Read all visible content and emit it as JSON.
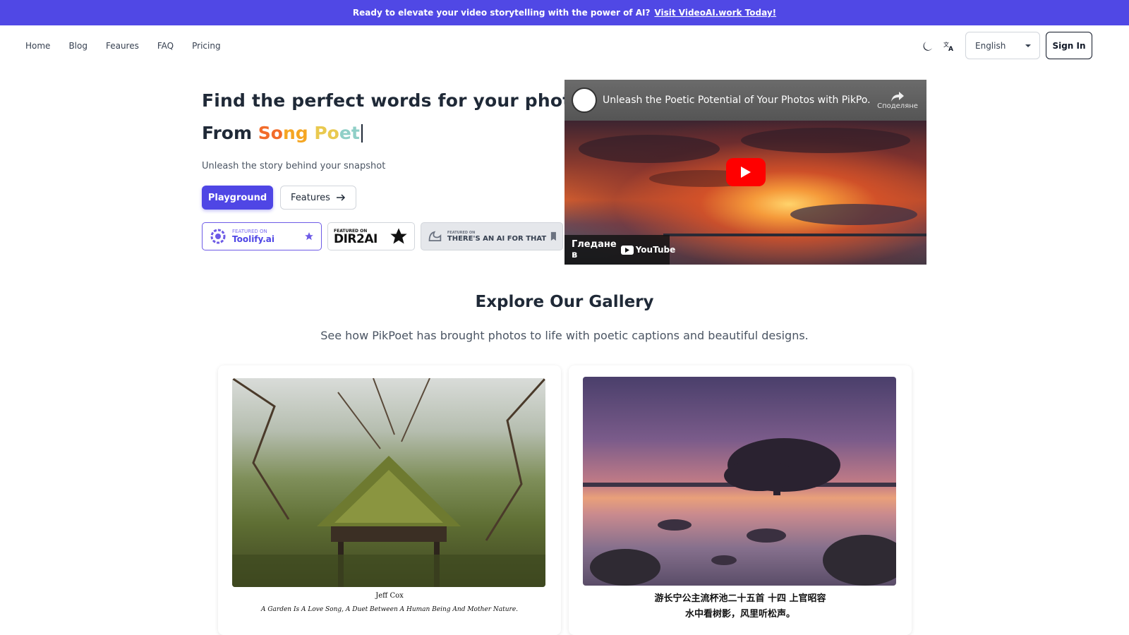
{
  "banner": {
    "text": "Ready to elevate your video storytelling with the power of AI?",
    "link": "Visit VideoAI.work Today!"
  },
  "nav": {
    "links": [
      "Home",
      "Blog",
      "Feaures",
      "FAQ",
      "Pricing"
    ],
    "language": "English",
    "sign_in": "Sign In",
    "icons": [
      "moon-icon",
      "translate-icon"
    ]
  },
  "hero": {
    "title": "Find the perfect words for your photos",
    "from": "From",
    "highlight": [
      "So",
      "ng",
      " Po",
      "et"
    ],
    "tagline": "Unleash the story behind your snapshot",
    "primary_button": "Playground",
    "secondary_button": "Features"
  },
  "badges": {
    "toolify": {
      "small": "FEATURED ON",
      "big": "Toolify.ai"
    },
    "dir2ai": {
      "small": "FEATURED ON",
      "big": "DIR2AI"
    },
    "aift": {
      "small": "FEATURED ON",
      "big": "THERE'S AN AI FOR THAT"
    }
  },
  "video": {
    "title": "Unleash the Poetic Potential of Your Photos with PikPo...",
    "share": "Споделяне",
    "watch_on": "Гледане в",
    "youtube": "YouTube"
  },
  "gallery": {
    "title": "Explore Our Gallery",
    "subtitle": "See how PikPoet has brought photos to life with poetic captions and beautiful designs.",
    "cards": [
      {
        "name": "Jeff Cox",
        "line": "A Garden Is A Love Song, A Duet Between A Human Being And Mother Nature."
      },
      {
        "name": "游长宁公主流杯池二十五首 十四 上官昭容",
        "line": "水中看树影，风里听松声。"
      }
    ]
  },
  "colors": {
    "accent": "#4f46e5",
    "banner": "#5048e5",
    "gradient": [
      "#f26b2a",
      "#f5a623",
      "#e9c94f",
      "#8fcfc7"
    ],
    "youtube_red": "#ff0000"
  }
}
